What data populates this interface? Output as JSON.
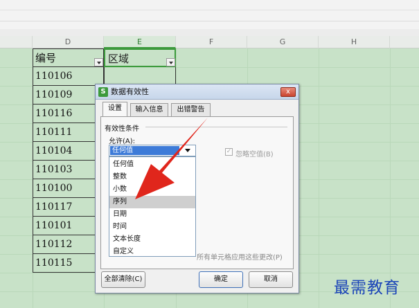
{
  "columns": [
    "D",
    "E",
    "F",
    "G",
    "H"
  ],
  "active_column": "E",
  "table": {
    "header_d": "编号",
    "header_e": "区域",
    "ids": [
      "110106",
      "110109",
      "110116",
      "110111",
      "110104",
      "110103",
      "110100",
      "110117",
      "110101",
      "110112",
      "110115"
    ]
  },
  "dialog": {
    "title": "数据有效性",
    "app_icon": "S",
    "close_label": "x",
    "tabs": [
      "设置",
      "输入信息",
      "出错警告"
    ],
    "section_label": "有效性条件",
    "allow_label": "允许(A):",
    "allow_selected": "任何值",
    "ignore_blank_label": "忽略空值(B)",
    "ignore_blank_checked": true,
    "dropdown_options": [
      "任何值",
      "整数",
      "小数",
      "序列",
      "日期",
      "时间",
      "文本长度",
      "自定义"
    ],
    "highlighted_option": "序列",
    "apply_all_text": "所有单元格应用这些更改(P)",
    "clear_all_button": "全部清除(C)",
    "ok_button": "确定",
    "cancel_button": "取消"
  },
  "watermark": "最需教育",
  "colors": {
    "sheet_background": "#c8e2c8",
    "selection_border": "#3c9a3c",
    "annotation_arrow": "#e0261c",
    "watermark": "#1c45b8"
  }
}
